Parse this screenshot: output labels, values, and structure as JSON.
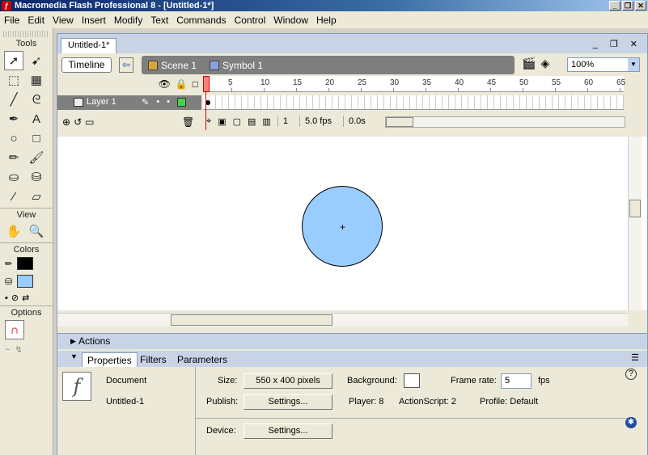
{
  "app": {
    "title": "Macromedia Flash Professional 8 - [Untitled-1*]",
    "icon": "flash-app-icon",
    "window_controls": [
      "_",
      "❐",
      "✕"
    ]
  },
  "menu": [
    "File",
    "Edit",
    "View",
    "Insert",
    "Modify",
    "Text",
    "Commands",
    "Control",
    "Window",
    "Help"
  ],
  "tools_panel": {
    "tools_label": "Tools",
    "view_label": "View",
    "colors_label": "Colors",
    "options_label": "Options",
    "tools": [
      {
        "name": "selection-tool-icon",
        "glyph": "➚"
      },
      {
        "name": "subselection-tool-icon",
        "glyph": "➹"
      },
      {
        "name": "free-transform-tool-icon",
        "glyph": "⬚"
      },
      {
        "name": "gradient-transform-tool-icon",
        "glyph": "▦"
      },
      {
        "name": "line-tool-icon",
        "glyph": "╱"
      },
      {
        "name": "lasso-tool-icon",
        "glyph": "ᘓ"
      },
      {
        "name": "pen-tool-icon",
        "glyph": "✒"
      },
      {
        "name": "text-tool-icon",
        "glyph": "A"
      },
      {
        "name": "oval-tool-icon",
        "glyph": "○"
      },
      {
        "name": "rectangle-tool-icon",
        "glyph": "□"
      },
      {
        "name": "pencil-tool-icon",
        "glyph": "✏"
      },
      {
        "name": "brush-tool-icon",
        "glyph": "🖌"
      },
      {
        "name": "ink-bottle-tool-icon",
        "glyph": "⛀"
      },
      {
        "name": "paint-bucket-tool-icon",
        "glyph": "⛁"
      },
      {
        "name": "eyedropper-tool-icon",
        "glyph": "⁄"
      },
      {
        "name": "eraser-tool-icon",
        "glyph": "▱"
      }
    ],
    "view_tools": [
      {
        "name": "hand-tool-icon",
        "glyph": "✋"
      },
      {
        "name": "zoom-tool-icon",
        "glyph": "🔍"
      }
    ],
    "stroke_color": "#000000",
    "fill_color": "#99ccff"
  },
  "document": {
    "tab_label": "Untitled-1*",
    "timeline_button": "Timeline",
    "breadcrumbs": [
      "Scene 1",
      "Symbol 1"
    ],
    "zoom": "100%",
    "ruler_numbers": [
      "1",
      "5",
      "10",
      "15",
      "20",
      "25",
      "30",
      "35",
      "40",
      "45",
      "50",
      "55",
      "60",
      "65"
    ],
    "layer_name": "Layer 1",
    "current_frame": "1",
    "frame_rate": "5.0 fps",
    "elapsed_time": "0.0s",
    "shape_fill": "#99ccff",
    "stage_color": "#ffffff"
  },
  "panels": {
    "actions_label": "Actions",
    "tabs": [
      "Properties",
      "Filters",
      "Parameters"
    ]
  },
  "properties": {
    "doc_type": "Document",
    "doc_name": "Untitled-1",
    "size_label": "Size:",
    "size_value": "550 x 400 pixels",
    "background_label": "Background:",
    "background_color": "#ffffff",
    "frame_rate_label": "Frame rate:",
    "frame_rate_value": "5",
    "fps_label": "fps",
    "publish_label": "Publish:",
    "settings_label": "Settings...",
    "player_label": "Player: 8",
    "actionscript_label": "ActionScript: 2",
    "profile_label": "Profile: Default",
    "device_label": "Device:",
    "device_settings_label": "Settings..."
  }
}
